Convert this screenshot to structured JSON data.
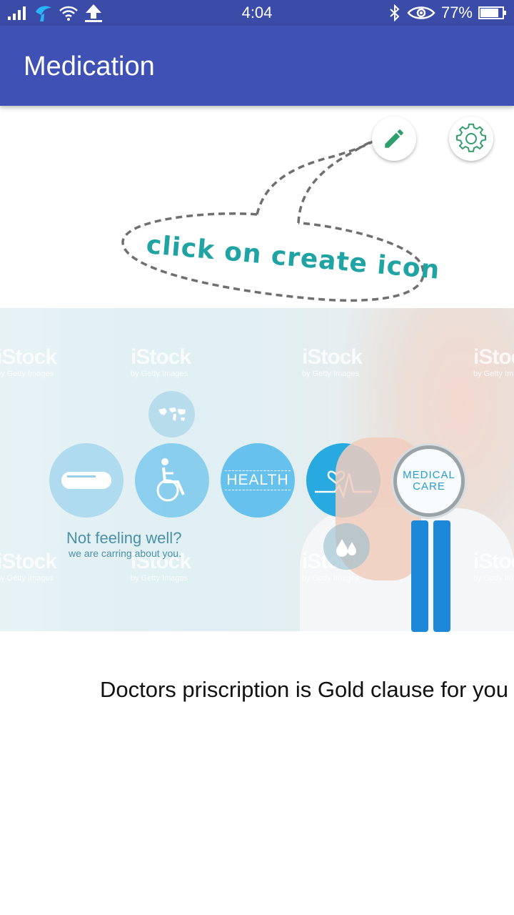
{
  "status_bar": {
    "time": "4:04",
    "battery": "77%",
    "icons": [
      "signal-icon",
      "telenor-icon",
      "wifi-icon",
      "upload-icon",
      "bluetooth-icon",
      "eye-icon",
      "battery-icon"
    ]
  },
  "app_bar": {
    "title": "Medication"
  },
  "actions": {
    "edit_icon": "pencil-icon",
    "settings_icon": "gear-icon"
  },
  "callout": {
    "text": "click on create icon"
  },
  "banner": {
    "watermark": "iStock",
    "watermark_sub": "by Getty Images",
    "health_label": "HEALTH",
    "medical_line1": "MEDICAL",
    "medical_line2": "CARE",
    "not_feeling": "Not feeling well?",
    "caring": "we are carring about you."
  },
  "tagline": "Doctors priscription is Gold clause for you",
  "colors": {
    "status_bar": "#3a4ba8",
    "app_bar": "#3f51b5",
    "fab_icon": "#2e9e6a",
    "callout": "#1fa3a3"
  }
}
